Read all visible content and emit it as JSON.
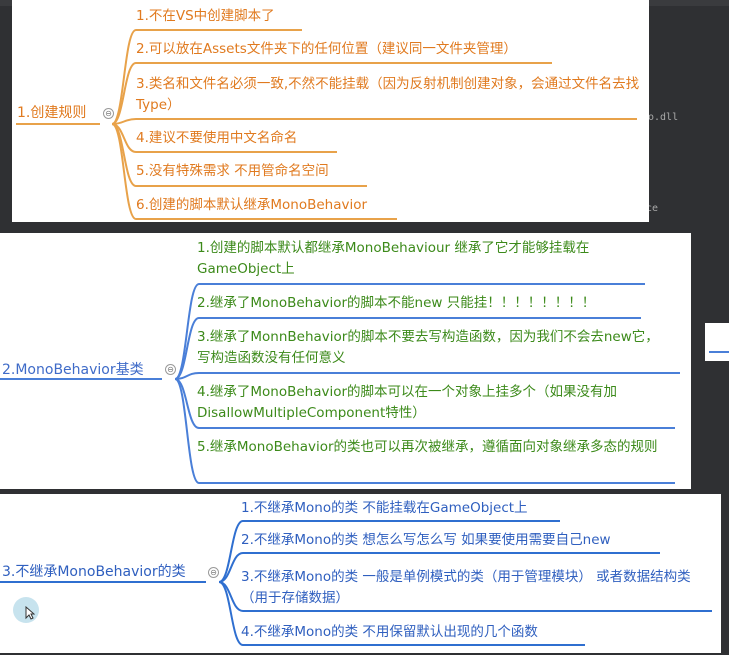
{
  "colors": {
    "panel1_text": "#e07a1f",
    "panel1_line": "#e8a24a",
    "panel2_root": "#3f6bc8",
    "panel2_text": "#3c8a1a",
    "panel2_line": "#4a7fd8",
    "panel3_text": "#2f5fbf",
    "panel3_line": "#2f6fd0",
    "background": "#2f3033"
  },
  "background": {
    "dll_label": "o.dll",
    "ce_label": "ce"
  },
  "panel1": {
    "root": "1.创建规则",
    "branches": [
      "1.不在VS中创建脚本了",
      "2.可以放在Assets文件夹下的任何位置（建议同一文件夹管理）",
      "3.类名和文件名必须一致,不然不能挂载（因为反射机制创建对象，会通过文件名去找Type）",
      "4.建议不要使用中文名命名",
      "5.没有特殊需求 不用管命名空间",
      "6.创建的脚本默认继承MonoBehavior"
    ]
  },
  "panel2": {
    "root": "2.MonoBehavior基类",
    "branches": [
      "1.创建的脚本默认都继承MonoBehaviour 继承了它才能够挂载在GameObject上",
      "2.继承了MonoBehavior的脚本不能new 只能挂！！！！！！！！",
      "3.继承了MonnBehavior的脚本不要去写构造函数，因为我们不会去new它，写构造函数没有任何意义",
      "4.继承了MonoBehavior的脚本可以在一个对象上挂多个（如果没有加DisallowMultipleComponent特性）",
      "5.继承MonoBehavior的类也可以再次被继承，遵循面向对象继承多态的规则"
    ]
  },
  "panel3": {
    "root": "3.不继承MonoBehavior的类",
    "branches": [
      "1.不继承Mono的类 不能挂载在GameObject上",
      "2.不继承Mono的类 想怎么写怎么写 如果要使用需要自己new",
      "3.不继承Mono的类 一般是单例模式的类（用于管理模块） 或者数据结构类（用于存储数据）",
      "4.不继承Mono的类 不用保留默认出现的几个函数"
    ]
  },
  "collapse_symbol": "⊖"
}
